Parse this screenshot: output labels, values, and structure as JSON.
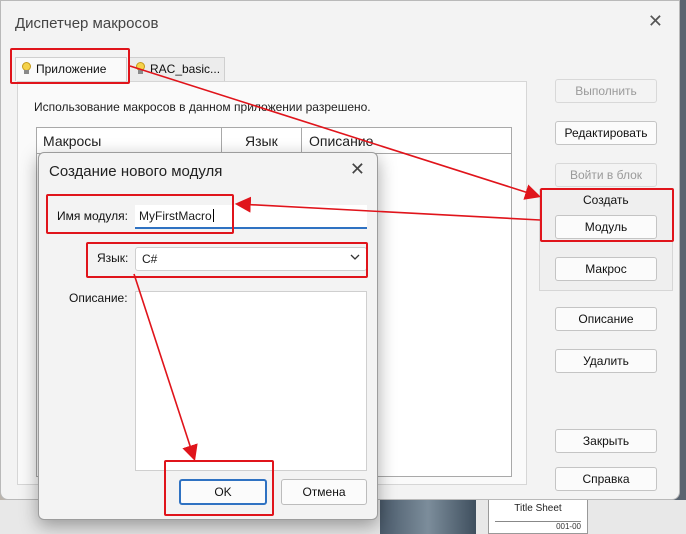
{
  "background": {
    "sheet_title": "Title Sheet",
    "sheet_number": "001-00"
  },
  "window": {
    "title": "Диспетчер макросов",
    "tabs": [
      {
        "label": "Приложение",
        "active": true
      },
      {
        "label": "RAC_basic...",
        "active": false
      }
    ],
    "message": "Использование макросов в данном приложении разрешено.",
    "columns": [
      "Макросы",
      "Язык",
      "Описание"
    ],
    "buttons": {
      "run": "Выполнить",
      "edit": "Редактировать",
      "step_into": "Войти в блок",
      "create_group": "Создать",
      "module": "Модуль",
      "macro": "Макрос",
      "description": "Описание",
      "delete": "Удалить",
      "close": "Закрыть",
      "help": "Справка"
    }
  },
  "dialog": {
    "title": "Создание нового модуля",
    "module_name_label": "Имя модуля:",
    "module_name_value": "MyFirstMacro",
    "language_label": "Язык:",
    "language_value": "C#",
    "description_label": "Описание:",
    "ok": "OK",
    "cancel": "Отмена"
  },
  "colors": {
    "highlight": "#e0141b",
    "accent": "#2f72c2"
  }
}
